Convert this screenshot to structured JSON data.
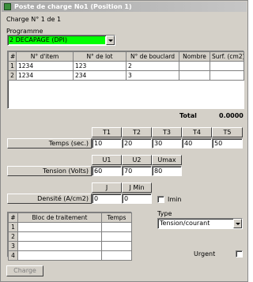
{
  "window": {
    "title": "Poste de charge No1 (Position 1)"
  },
  "charge_counter": "Charge N° 1 de 1",
  "programme": {
    "label": "Programme",
    "value": "2 DECAPAGE (DPI)",
    "highlight_color": "#00ff00"
  },
  "items_table": {
    "headers": [
      "#",
      "N° d'item",
      "N° de lot",
      "N° de bouclard",
      "Nombre",
      "Surf. (cm2)"
    ],
    "rows": [
      {
        "n": "1",
        "item": "1234",
        "lot": "123",
        "bouclard": "2",
        "nombre": "",
        "surf": ""
      },
      {
        "n": "2",
        "item": "1234",
        "lot": "234",
        "bouclard": "3",
        "nombre": "",
        "surf": ""
      }
    ]
  },
  "total": {
    "label": "Total",
    "value": "0.0000"
  },
  "temps": {
    "label": "Temps (sec.)",
    "headers": [
      "T1",
      "T2",
      "T3",
      "T4",
      "T5"
    ],
    "values": [
      "10",
      "20",
      "30",
      "40",
      "50"
    ]
  },
  "tension": {
    "label": "Tension (Volts)",
    "headers": [
      "U1",
      "U2",
      "Umax"
    ],
    "values": [
      "60",
      "70",
      "80"
    ]
  },
  "densite": {
    "label": "Densité (A/cm2)",
    "headers": [
      "J",
      "J Min"
    ],
    "values": [
      "0",
      "0"
    ],
    "imin_label": "Imin"
  },
  "bloc_table": {
    "headers": [
      "#",
      "Bloc de traitement",
      "Temps"
    ],
    "rows": [
      {
        "n": "1",
        "bloc": "",
        "temps": ""
      },
      {
        "n": "2",
        "bloc": "",
        "temps": ""
      },
      {
        "n": "3",
        "bloc": "",
        "temps": ""
      },
      {
        "n": "4",
        "bloc": "",
        "temps": ""
      }
    ]
  },
  "type": {
    "label": "Type",
    "value": "Tension/courant"
  },
  "urgent": {
    "label": "Urgent",
    "checked": false
  },
  "charge_button": {
    "label": "Charge",
    "enabled": false
  }
}
